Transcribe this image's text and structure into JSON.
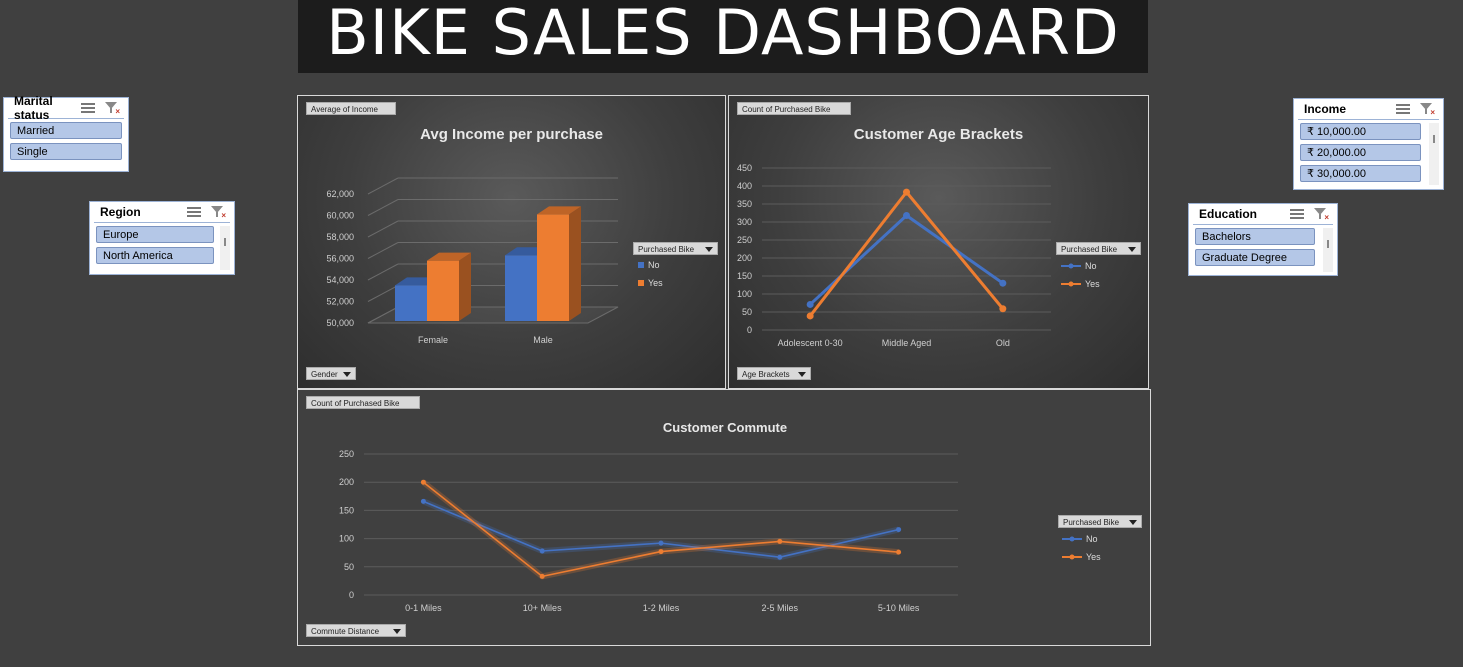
{
  "dashboard": {
    "title": "BIKE SALES DASHBOARD"
  },
  "slicers": {
    "marital": {
      "title": "Marital status",
      "items": [
        "Married",
        "Single"
      ]
    },
    "region": {
      "title": "Region",
      "items": [
        "Europe",
        "North America"
      ]
    },
    "income": {
      "title": "Income",
      "items": [
        "₹ 10,000.00",
        "₹ 20,000.00",
        "₹ 30,000.00"
      ]
    },
    "education": {
      "title": "Education",
      "items": [
        "Bachelors",
        "Graduate Degree"
      ]
    }
  },
  "colors": {
    "no": "#4472c4",
    "yes": "#ed7d31",
    "background": "#404040"
  },
  "chart_data": [
    {
      "type": "bar",
      "title": "Avg Income per purchase",
      "value_field": "Average of Income",
      "axis_field": "Gender",
      "legend_title": "Purchased Bike",
      "categories": [
        "Female",
        "Male"
      ],
      "series": [
        {
          "name": "No",
          "values": [
            53500,
            56300
          ]
        },
        {
          "name": "Yes",
          "values": [
            55800,
            60100
          ]
        }
      ],
      "yticks": [
        "50,000",
        "52,000",
        "54,000",
        "56,000",
        "58,000",
        "60,000",
        "62,000"
      ],
      "ylim": [
        50000,
        62000
      ],
      "legend_position": "right"
    },
    {
      "type": "line",
      "title": "Customer Age Brackets",
      "value_field": "Count of Purchased Bike",
      "axis_field": "Age Brackets",
      "legend_title": "Purchased Bike",
      "categories": [
        "Adolescent 0-30",
        "Middle Aged",
        "Old"
      ],
      "series": [
        {
          "name": "No",
          "values": [
            71,
            318,
            130
          ]
        },
        {
          "name": "Yes",
          "values": [
            39,
            383,
            59
          ]
        }
      ],
      "yticks": [
        "0",
        "50",
        "100",
        "150",
        "200",
        "250",
        "300",
        "350",
        "400",
        "450"
      ],
      "ylim": [
        0,
        450
      ],
      "legend_position": "right"
    },
    {
      "type": "line",
      "title": "Customer Commute",
      "value_field": "Count of Purchased Bike",
      "axis_field": "Commute Distance",
      "legend_title": "Purchased Bike",
      "categories": [
        "0-1 Miles",
        "10+ Miles",
        "1-2 Miles",
        "2-5 Miles",
        "5-10 Miles"
      ],
      "series": [
        {
          "name": "No",
          "values": [
            166,
            78,
            92,
            67,
            116
          ]
        },
        {
          "name": "Yes",
          "values": [
            200,
            33,
            77,
            95,
            76
          ]
        }
      ],
      "yticks": [
        "0",
        "50",
        "100",
        "150",
        "200",
        "250"
      ],
      "ylim": [
        0,
        250
      ],
      "legend_position": "right"
    }
  ]
}
